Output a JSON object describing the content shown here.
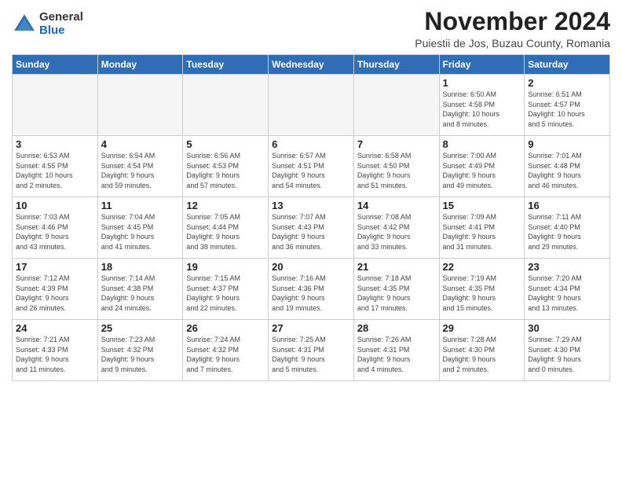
{
  "logo": {
    "general": "General",
    "blue": "Blue"
  },
  "title": "November 2024",
  "subtitle": "Puiestii de Jos, Buzau County, Romania",
  "headers": [
    "Sunday",
    "Monday",
    "Tuesday",
    "Wednesday",
    "Thursday",
    "Friday",
    "Saturday"
  ],
  "weeks": [
    [
      {
        "day": "",
        "info": ""
      },
      {
        "day": "",
        "info": ""
      },
      {
        "day": "",
        "info": ""
      },
      {
        "day": "",
        "info": ""
      },
      {
        "day": "",
        "info": ""
      },
      {
        "day": "1",
        "info": "Sunrise: 6:50 AM\nSunset: 4:58 PM\nDaylight: 10 hours\nand 8 minutes."
      },
      {
        "day": "2",
        "info": "Sunrise: 6:51 AM\nSunset: 4:57 PM\nDaylight: 10 hours\nand 5 minutes."
      }
    ],
    [
      {
        "day": "3",
        "info": "Sunrise: 6:53 AM\nSunset: 4:55 PM\nDaylight: 10 hours\nand 2 minutes."
      },
      {
        "day": "4",
        "info": "Sunrise: 6:54 AM\nSunset: 4:54 PM\nDaylight: 9 hours\nand 59 minutes."
      },
      {
        "day": "5",
        "info": "Sunrise: 6:56 AM\nSunset: 4:53 PM\nDaylight: 9 hours\nand 57 minutes."
      },
      {
        "day": "6",
        "info": "Sunrise: 6:57 AM\nSunset: 4:51 PM\nDaylight: 9 hours\nand 54 minutes."
      },
      {
        "day": "7",
        "info": "Sunrise: 6:58 AM\nSunset: 4:50 PM\nDaylight: 9 hours\nand 51 minutes."
      },
      {
        "day": "8",
        "info": "Sunrise: 7:00 AM\nSunset: 4:49 PM\nDaylight: 9 hours\nand 49 minutes."
      },
      {
        "day": "9",
        "info": "Sunrise: 7:01 AM\nSunset: 4:48 PM\nDaylight: 9 hours\nand 46 minutes."
      }
    ],
    [
      {
        "day": "10",
        "info": "Sunrise: 7:03 AM\nSunset: 4:46 PM\nDaylight: 9 hours\nand 43 minutes."
      },
      {
        "day": "11",
        "info": "Sunrise: 7:04 AM\nSunset: 4:45 PM\nDaylight: 9 hours\nand 41 minutes."
      },
      {
        "day": "12",
        "info": "Sunrise: 7:05 AM\nSunset: 4:44 PM\nDaylight: 9 hours\nand 38 minutes."
      },
      {
        "day": "13",
        "info": "Sunrise: 7:07 AM\nSunset: 4:43 PM\nDaylight: 9 hours\nand 36 minutes."
      },
      {
        "day": "14",
        "info": "Sunrise: 7:08 AM\nSunset: 4:42 PM\nDaylight: 9 hours\nand 33 minutes."
      },
      {
        "day": "15",
        "info": "Sunrise: 7:09 AM\nSunset: 4:41 PM\nDaylight: 9 hours\nand 31 minutes."
      },
      {
        "day": "16",
        "info": "Sunrise: 7:11 AM\nSunset: 4:40 PM\nDaylight: 9 hours\nand 29 minutes."
      }
    ],
    [
      {
        "day": "17",
        "info": "Sunrise: 7:12 AM\nSunset: 4:39 PM\nDaylight: 9 hours\nand 26 minutes."
      },
      {
        "day": "18",
        "info": "Sunrise: 7:14 AM\nSunset: 4:38 PM\nDaylight: 9 hours\nand 24 minutes."
      },
      {
        "day": "19",
        "info": "Sunrise: 7:15 AM\nSunset: 4:37 PM\nDaylight: 9 hours\nand 22 minutes."
      },
      {
        "day": "20",
        "info": "Sunrise: 7:16 AM\nSunset: 4:36 PM\nDaylight: 9 hours\nand 19 minutes."
      },
      {
        "day": "21",
        "info": "Sunrise: 7:18 AM\nSunset: 4:35 PM\nDaylight: 9 hours\nand 17 minutes."
      },
      {
        "day": "22",
        "info": "Sunrise: 7:19 AM\nSunset: 4:35 PM\nDaylight: 9 hours\nand 15 minutes."
      },
      {
        "day": "23",
        "info": "Sunrise: 7:20 AM\nSunset: 4:34 PM\nDaylight: 9 hours\nand 13 minutes."
      }
    ],
    [
      {
        "day": "24",
        "info": "Sunrise: 7:21 AM\nSunset: 4:33 PM\nDaylight: 9 hours\nand 11 minutes."
      },
      {
        "day": "25",
        "info": "Sunrise: 7:23 AM\nSunset: 4:32 PM\nDaylight: 9 hours\nand 9 minutes."
      },
      {
        "day": "26",
        "info": "Sunrise: 7:24 AM\nSunset: 4:32 PM\nDaylight: 9 hours\nand 7 minutes."
      },
      {
        "day": "27",
        "info": "Sunrise: 7:25 AM\nSunset: 4:31 PM\nDaylight: 9 hours\nand 5 minutes."
      },
      {
        "day": "28",
        "info": "Sunrise: 7:26 AM\nSunset: 4:31 PM\nDaylight: 9 hours\nand 4 minutes."
      },
      {
        "day": "29",
        "info": "Sunrise: 7:28 AM\nSunset: 4:30 PM\nDaylight: 9 hours\nand 2 minutes."
      },
      {
        "day": "30",
        "info": "Sunrise: 7:29 AM\nSunset: 4:30 PM\nDaylight: 9 hours\nand 0 minutes."
      }
    ]
  ]
}
